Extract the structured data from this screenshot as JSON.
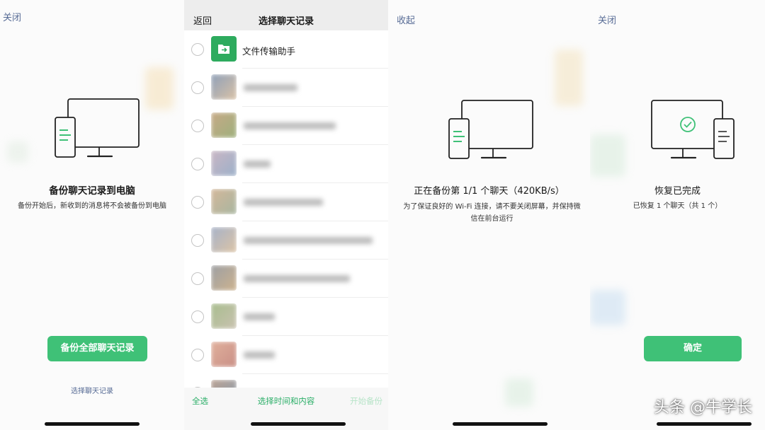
{
  "panel1": {
    "close_link": "关闭",
    "heading": "备份聊天记录到电脑",
    "description": "备份开始后，新收到的消息将不会被备份到电脑",
    "backup_all_button": "备份全部聊天记录",
    "select_chats_link": "选择聊天记录"
  },
  "panel2": {
    "back_link": "返回",
    "title": "选择聊天记录",
    "first_chat_name": "文件传输助手",
    "footer": {
      "select_all": "全选",
      "select_time_content": "选择时间和内容",
      "start_backup": "开始备份"
    }
  },
  "panel3": {
    "collapse_link": "收起",
    "progress_heading": "正在备份第 1/1 个聊天（420KB/s）",
    "notice": "为了保证良好的 Wi-Fi 连接，请不要关闭屏幕，并保持微信在前台运行"
  },
  "panel4": {
    "close_link": "关闭",
    "heading": "恢复已完成",
    "summary": "已恢复 1 个聊天（共 1 个）",
    "confirm_button": "确定"
  },
  "watermark": "头条 @牛学长",
  "colors": {
    "accent_green": "#3fc177",
    "link_blue": "#576b95",
    "footer_green": "#2aae67"
  }
}
